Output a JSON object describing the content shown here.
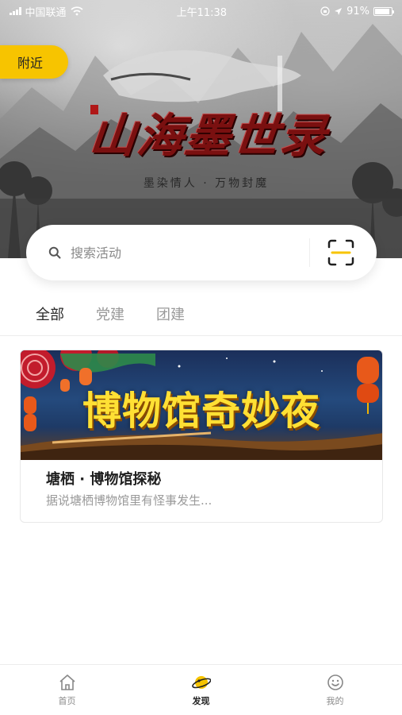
{
  "status_bar": {
    "carrier": "中国联通",
    "time": "上午11:38",
    "battery": "91%",
    "battery_level": 0.91
  },
  "hero": {
    "nearby_label": "附近",
    "banner_title": "山海墨世录",
    "banner_subtitle": "墨染情人 · 万物封魔"
  },
  "search": {
    "placeholder": "搜索活动",
    "search_icon": "search-icon",
    "scan_icon": "scan-icon"
  },
  "tabs": [
    {
      "label": "全部",
      "active": true
    },
    {
      "label": "党建",
      "active": false
    },
    {
      "label": "团建",
      "active": false
    }
  ],
  "activities": [
    {
      "banner_text": "博物馆奇妙夜",
      "title": "塘栖 · 博物馆探秘",
      "description": "据说塘栖博物馆里有怪事发生..."
    }
  ],
  "tabbar": [
    {
      "label": "首页",
      "icon": "home-icon",
      "active": false
    },
    {
      "label": "发现",
      "icon": "planet-icon",
      "active": true
    },
    {
      "label": "我的",
      "icon": "smiley-icon",
      "active": false
    }
  ],
  "colors": {
    "accent": "#f7c400",
    "text_primary": "#1f1f1f",
    "text_secondary": "#9a9a9a"
  }
}
